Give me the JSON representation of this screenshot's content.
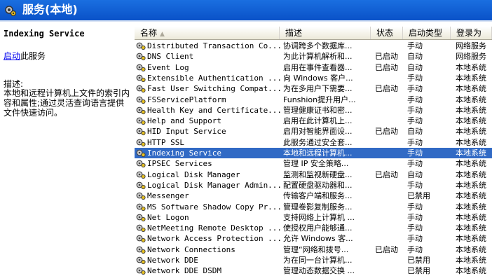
{
  "header": {
    "title": "服务(本地)",
    "icon": "gears-icon"
  },
  "left": {
    "title": "Indexing Service",
    "start_link": "启动",
    "start_suffix": "此服务",
    "desc_label": "描述:",
    "desc": "本地和远程计算机上文件的索引内容和属性;通过灵活查询语言提供文件快速访问。"
  },
  "columns": {
    "name": "名称",
    "desc": "描述",
    "status": "状态",
    "startup": "启动类型",
    "logon": "登录为"
  },
  "colors": {
    "header_bg": "#1463d8",
    "selection": "#316ac5"
  },
  "rows": [
    {
      "name": "Distributed Transaction Co...",
      "desc": "协调跨多个数据库...",
      "status": "",
      "startup": "手动",
      "logon": "网络服务"
    },
    {
      "name": "DNS Client",
      "desc": "为此计算机解析和...",
      "status": "已启动",
      "startup": "自动",
      "logon": "网络服务"
    },
    {
      "name": "Event Log",
      "desc": "启用在事件查看器...",
      "status": "已启动",
      "startup": "自动",
      "logon": "本地系统"
    },
    {
      "name": "Extensible Authentication ...",
      "desc": "向 Windows 客户...",
      "status": "",
      "startup": "手动",
      "logon": "本地系统"
    },
    {
      "name": "Fast User Switching Compat...",
      "desc": "为在多用户下需要...",
      "status": "已启动",
      "startup": "手动",
      "logon": "本地系统"
    },
    {
      "name": "FSServicePlatform",
      "desc": "Funshion提升用户...",
      "status": "",
      "startup": "手动",
      "logon": "本地系统"
    },
    {
      "name": "Health Key and Certificate...",
      "desc": "管理健康证书和密...",
      "status": "",
      "startup": "手动",
      "logon": "本地系统"
    },
    {
      "name": "Help and Support",
      "desc": "启用在此计算机上...",
      "status": "",
      "startup": "手动",
      "logon": "本地系统"
    },
    {
      "name": "HID Input Service",
      "desc": "启用对智能界面设...",
      "status": "已启动",
      "startup": "自动",
      "logon": "本地系统"
    },
    {
      "name": "HTTP SSL",
      "desc": "此服务通过安全套...",
      "status": "",
      "startup": "手动",
      "logon": "本地系统"
    },
    {
      "name": "Indexing Service",
      "desc": "本地和远程计算机...",
      "status": "",
      "startup": "手动",
      "logon": "本地系统",
      "selected": true
    },
    {
      "name": "IPSEC Services",
      "desc": "管理 IP 安全策略...",
      "status": "",
      "startup": "手动",
      "logon": "本地系统"
    },
    {
      "name": "Logical Disk Manager",
      "desc": "监测和监视新硬盘...",
      "status": "已启动",
      "startup": "自动",
      "logon": "本地系统"
    },
    {
      "name": "Logical Disk Manager Admin...",
      "desc": "配置硬盘驱动器和...",
      "status": "",
      "startup": "手动",
      "logon": "本地系统"
    },
    {
      "name": "Messenger",
      "desc": "传输客户端和服务...",
      "status": "",
      "startup": "已禁用",
      "logon": "本地系统"
    },
    {
      "name": "MS Software Shadow Copy Pr...",
      "desc": "管理卷影复制服务...",
      "status": "",
      "startup": "手动",
      "logon": "本地系统"
    },
    {
      "name": "Net Logon",
      "desc": "支持网络上计算机 ...",
      "status": "",
      "startup": "手动",
      "logon": "本地系统"
    },
    {
      "name": "NetMeeting Remote Desktop ...",
      "desc": "使授权用户能够通...",
      "status": "",
      "startup": "手动",
      "logon": "本地系统"
    },
    {
      "name": "Network Access Protection ...",
      "desc": "允许 Windows 客...",
      "status": "",
      "startup": "手动",
      "logon": "本地系统"
    },
    {
      "name": "Network Connections",
      "desc": "管理“网络和拨号...",
      "status": "已启动",
      "startup": "手动",
      "logon": "本地系统"
    },
    {
      "name": "Network DDE",
      "desc": "为在同一台计算机...",
      "status": "",
      "startup": "已禁用",
      "logon": "本地系统"
    },
    {
      "name": "Network DDE DSDM",
      "desc": "管理动态数据交换 ...",
      "status": "",
      "startup": "已禁用",
      "logon": "本地系统"
    }
  ]
}
